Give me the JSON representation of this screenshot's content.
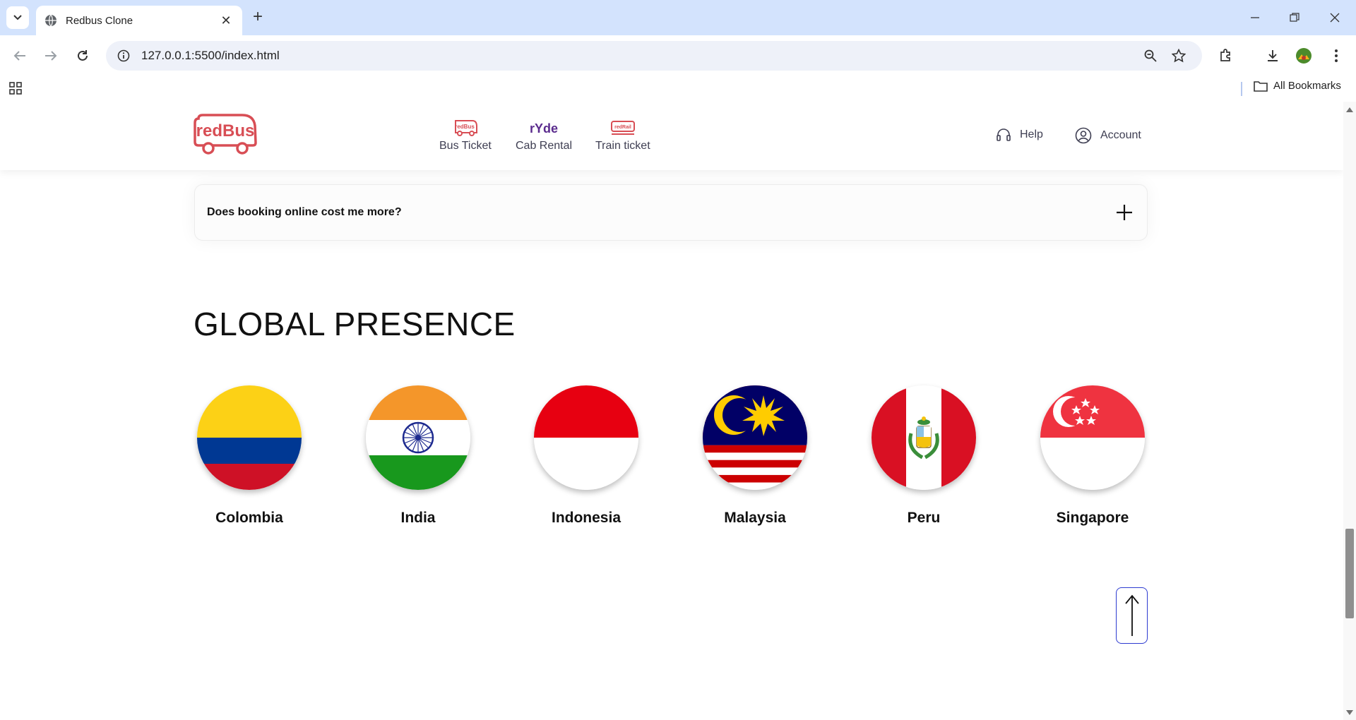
{
  "browser": {
    "tab_title": "Redbus Clone",
    "url": "127.0.0.1:5500/index.html",
    "bookmarks_label": "All Bookmarks"
  },
  "header": {
    "logo_text": "redBus",
    "nav": [
      {
        "label": "Bus Ticket",
        "icon": "bus-ticket-icon"
      },
      {
        "label": "Cab Rental",
        "icon": "ryde-icon"
      },
      {
        "label": "Train ticket",
        "icon": "redrail-icon"
      }
    ],
    "help_label": "Help",
    "account_label": "Account"
  },
  "faq": {
    "question": "Does booking online cost me more?"
  },
  "global_presence": {
    "title": "GLOBAL PRESENCE",
    "countries": [
      {
        "name": "Colombia"
      },
      {
        "name": "India"
      },
      {
        "name": "Indonesia"
      },
      {
        "name": "Malaysia"
      },
      {
        "name": "Peru"
      },
      {
        "name": "Singapore"
      }
    ]
  },
  "colors": {
    "brand_red": "#d84e55",
    "ryde_purple": "#5b2c8e",
    "back_to_top_border": "#2d3bd1"
  }
}
